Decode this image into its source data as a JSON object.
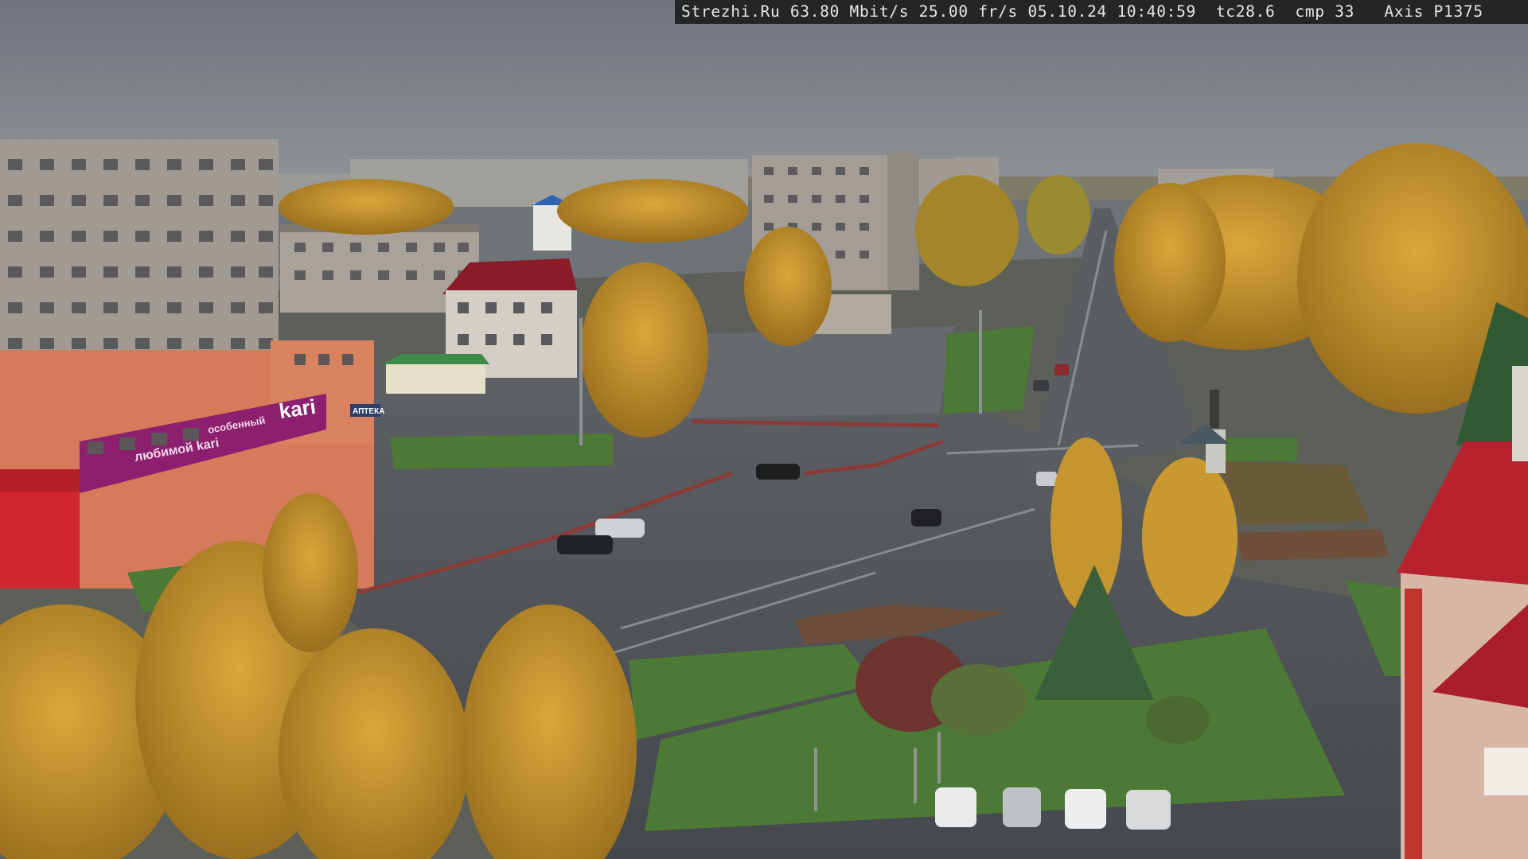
{
  "osd": {
    "site": "Strezhi.Ru",
    "bitrate": "63.80 Mbit/s",
    "framerate": "25.00 fr/s",
    "date": "05.10.24",
    "time": "10:40:59",
    "tc": "tc28.6",
    "cmp": "cmp 33",
    "camera": "Axis P1375"
  },
  "signs": {
    "store_brand": "kari",
    "store_slogan_1": "любимой kari",
    "store_slogan_2": "особенный",
    "pharmacy": "АПТЕКА"
  },
  "colors": {
    "sky": "#7c8188",
    "road": "#4d5054",
    "foliage": "#c9962a",
    "grass": "#4c7a36",
    "kari_magenta": "#8c1f6e",
    "roof_red": "#b8222e"
  }
}
